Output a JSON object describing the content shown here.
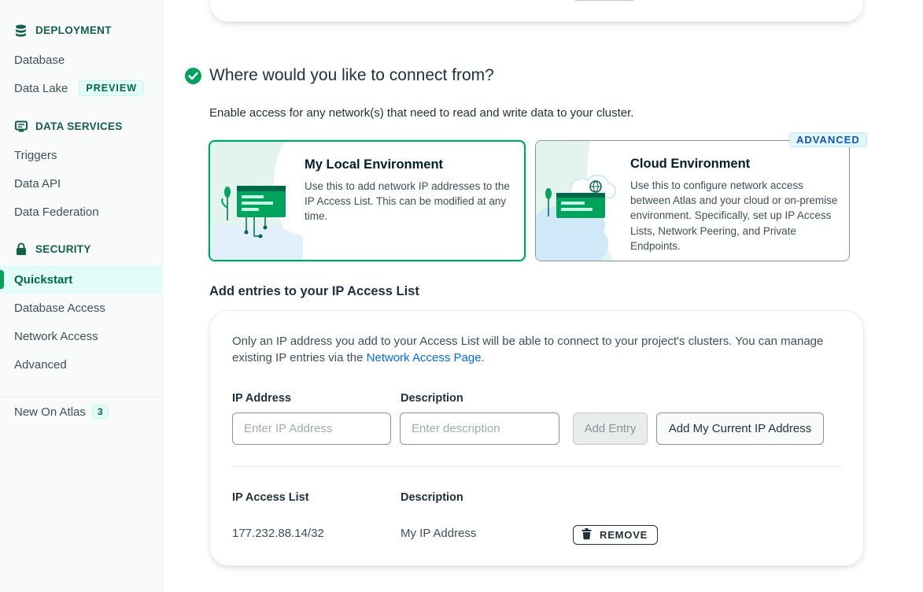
{
  "colors": {
    "brand_green": "#00a35c",
    "dark_green": "#00684a",
    "link_blue": "#016bf8",
    "advanced_blue": "#1254b7"
  },
  "sidebar": {
    "sections": [
      {
        "title": "DEPLOYMENT",
        "icon": "database-icon"
      },
      {
        "title": "DATA SERVICES",
        "icon": "monitor-icon"
      },
      {
        "title": "SECURITY",
        "icon": "lock-icon"
      }
    ],
    "items": [
      {
        "label": "Database"
      },
      {
        "label": "Data Lake",
        "badge": "PREVIEW"
      },
      {
        "label": "Triggers"
      },
      {
        "label": "Data API"
      },
      {
        "label": "Data Federation"
      },
      {
        "label": "Quickstart",
        "active": true
      },
      {
        "label": "Database Access"
      },
      {
        "label": "Network Access"
      },
      {
        "label": "Advanced"
      }
    ],
    "new_on_atlas": {
      "label": "New On Atlas",
      "count": "3"
    }
  },
  "main": {
    "section_title": "Where would you like to connect from?",
    "subtitle": "Enable access for any network(s) that need to read and write data to your cluster.",
    "env_cards": [
      {
        "title": "My Local Environment",
        "description": "Use this to add network IP addresses to the IP Access List. This can be modified at any time.",
        "selected": true
      },
      {
        "title": "Cloud Environment",
        "badge": "ADVANCED",
        "description": "Use this to configure network access between Atlas and your cloud or on-premise environment. Specifically, set up IP Access Lists, Network Peering, and Private Endpoints."
      }
    ],
    "ip_section": {
      "title": "Add entries to your IP Access List",
      "info_text": "Only an IP address you add to your Access List will be able to connect to your project's clusters. You can manage existing IP entries via the",
      "info_link": "Network Access Page.",
      "ip_label": "IP Address",
      "ip_placeholder": "Enter IP Address",
      "desc_label": "Description",
      "desc_placeholder": "Enter description",
      "add_entry_label": "Add Entry",
      "add_current_label": "Add My Current IP Address",
      "table_headers": [
        "IP Access List",
        "Description"
      ],
      "rows": [
        {
          "ip": "177.232.88.14/32",
          "description": "My IP Address",
          "action": "REMOVE"
        }
      ]
    }
  }
}
